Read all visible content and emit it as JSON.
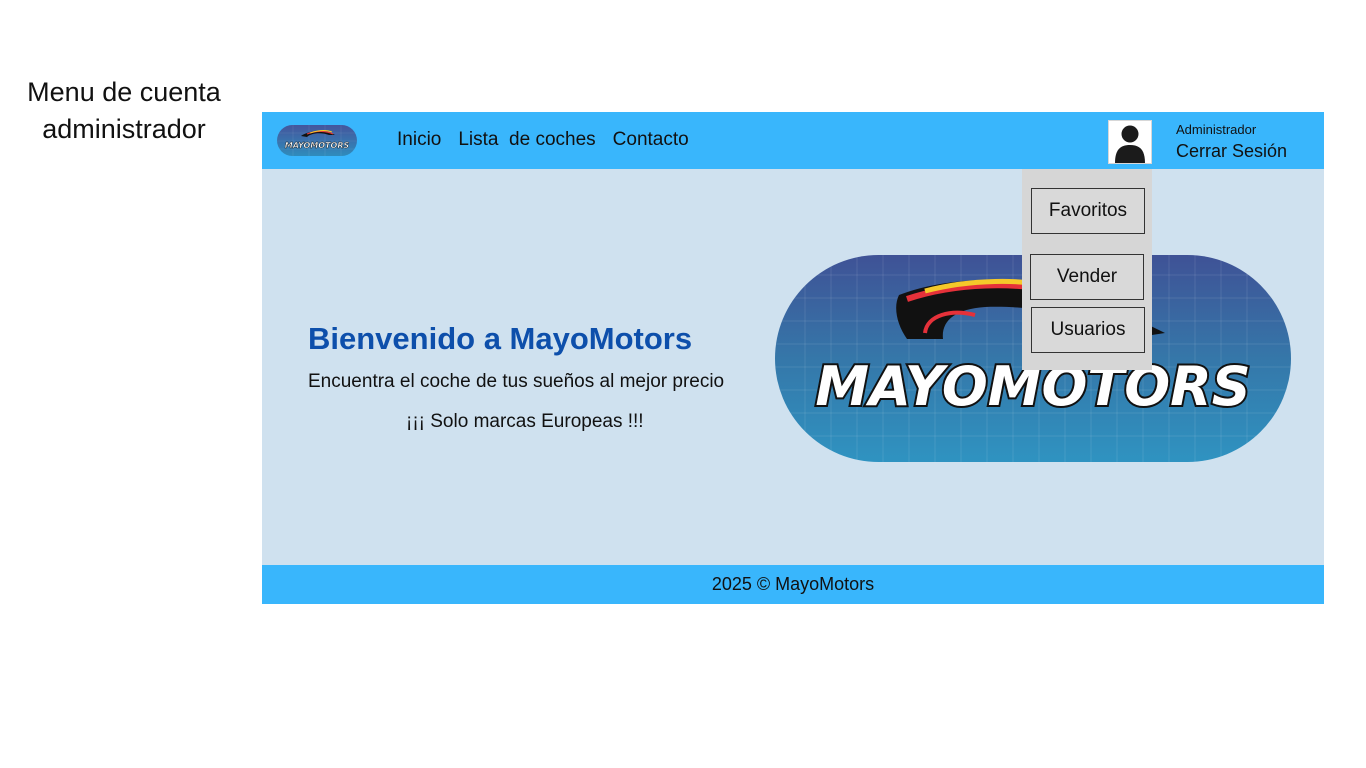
{
  "caption": {
    "line1": "Menu de cuenta",
    "line2": "administrador"
  },
  "navbar": {
    "logo_text": "MAYOMOTORS",
    "links": [
      {
        "label": "Inicio"
      },
      {
        "label": "Lista  de coches"
      },
      {
        "label": "Contacto"
      }
    ],
    "user_role": "Administrador",
    "logout_label": "Cerrar Sesión",
    "avatar_icon": "user-silhouette-icon"
  },
  "dropdown": {
    "items": [
      {
        "label": "Favoritos"
      },
      {
        "label": "Vender"
      },
      {
        "label": "Usuarios"
      }
    ]
  },
  "hero": {
    "title": "Bienvenido a MayoMotors",
    "subtitle": "Encuentra el coche de tus sueños al mejor precio",
    "note": "¡¡¡ Solo marcas Europeas !!!",
    "banner_text": "MAYOMOTORS"
  },
  "footer": {
    "text": "2025 © MayoMotors"
  },
  "colors": {
    "navbar": "#39b6fc",
    "hero_background": "#cfe1ef",
    "title": "#0d4fab",
    "dropdown_panel": "#d6d6d6",
    "footer": "#39b6fc"
  }
}
